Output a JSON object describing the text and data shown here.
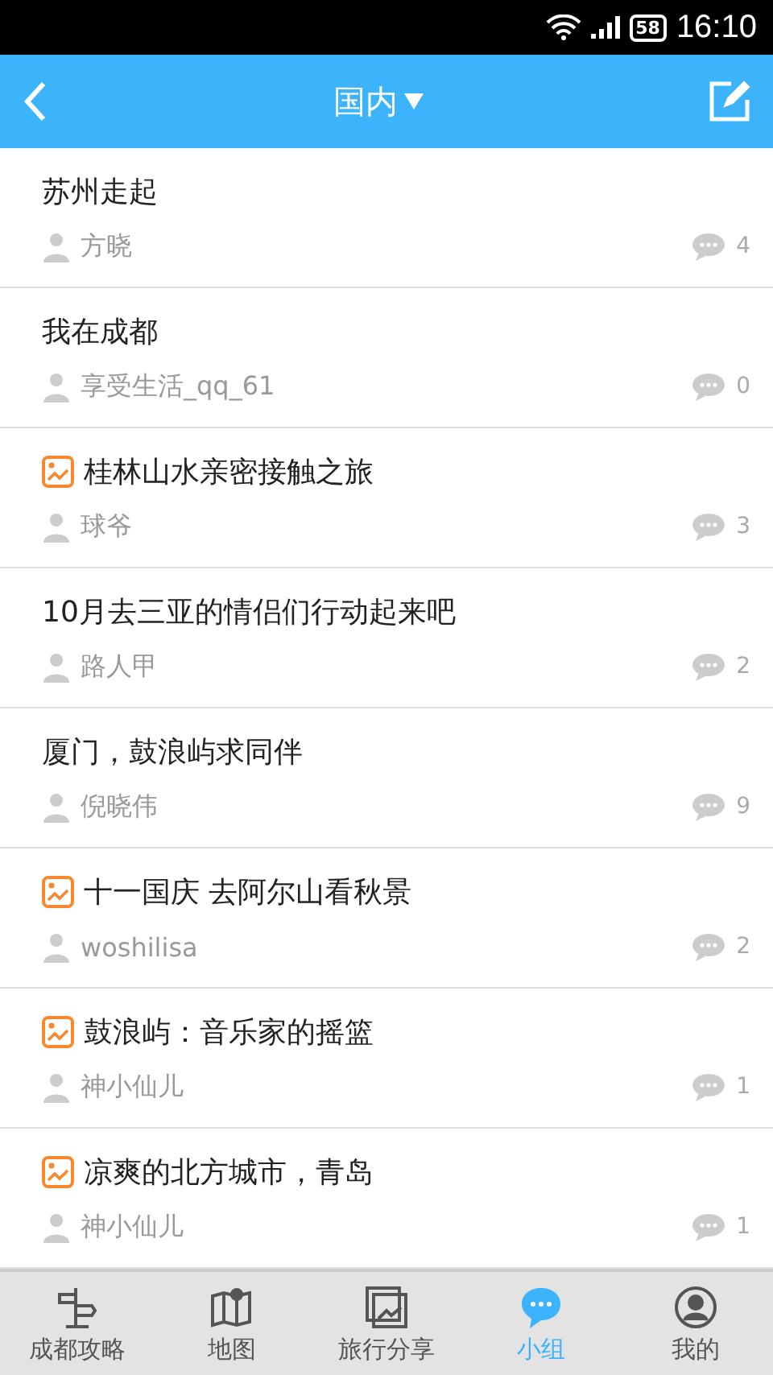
{
  "status_bar": {
    "battery": "58",
    "time": "16:10"
  },
  "header": {
    "title": "国内"
  },
  "posts": [
    {
      "title": "苏州走起",
      "has_image": false,
      "author": "方晓",
      "comments": "4"
    },
    {
      "title": "我在成都",
      "has_image": false,
      "author": "享受生活_qq_61",
      "comments": "0"
    },
    {
      "title": "桂林山水亲密接触之旅",
      "has_image": true,
      "author": "球爷",
      "comments": "3"
    },
    {
      "title": "10月去三亚的情侣们行动起来吧",
      "has_image": false,
      "author": "路人甲",
      "comments": "2"
    },
    {
      "title": "厦门，鼓浪屿求同伴",
      "has_image": false,
      "author": "倪晓伟",
      "comments": "9"
    },
    {
      "title": "十一国庆 去阿尔山看秋景",
      "has_image": true,
      "author": "woshilisa",
      "comments": "2"
    },
    {
      "title": "鼓浪屿：音乐家的摇篮",
      "has_image": true,
      "author": "神小仙儿",
      "comments": "1"
    },
    {
      "title": "凉爽的北方城市，青岛",
      "has_image": true,
      "author": "神小仙儿",
      "comments": "1"
    }
  ],
  "tabs": [
    {
      "kind": "signpost",
      "label": "成都攻略",
      "selected": false
    },
    {
      "kind": "map",
      "label": "地图",
      "selected": false
    },
    {
      "kind": "photo",
      "label": "旅行分享",
      "selected": false
    },
    {
      "kind": "chat",
      "label": "小组",
      "selected": true
    },
    {
      "kind": "person",
      "label": "我的",
      "selected": false
    }
  ]
}
